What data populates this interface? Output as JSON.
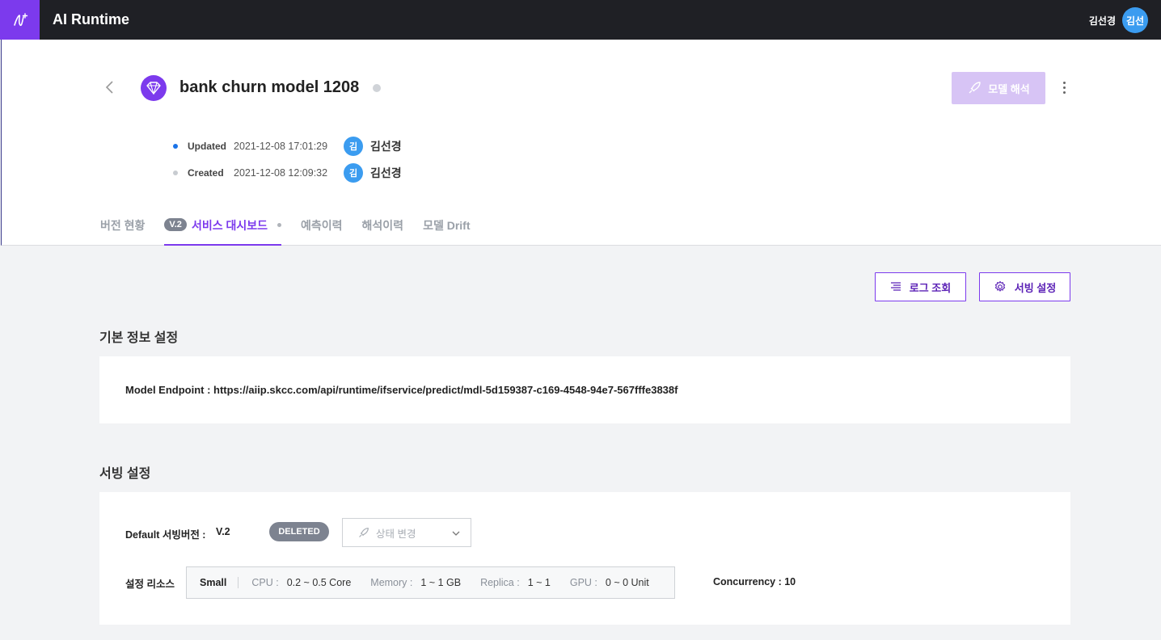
{
  "app": {
    "title": "AI Runtime",
    "logo_icon": "ai-logo-icon"
  },
  "user": {
    "name": "김선경",
    "avatar_text": "김선"
  },
  "model": {
    "title": "bank churn model 1208",
    "icon": "diamond-icon"
  },
  "header_actions": {
    "interpret_label": "모델 해석"
  },
  "meta": {
    "updated": {
      "label": "Updated",
      "timestamp": "2021-12-08 17:01:29",
      "avatar": "김",
      "user": "김선경",
      "dot_color": "#1a73e8"
    },
    "created": {
      "label": "Created",
      "timestamp": "2021-12-08 12:09:32",
      "avatar": "김",
      "user": "김선경",
      "dot_color": "#c8ccd1"
    }
  },
  "tabs": [
    {
      "label": "버전 현황"
    },
    {
      "label": "서비스 대시보드",
      "badge": "V.2",
      "active": true
    },
    {
      "label": "예측이력"
    },
    {
      "label": "해석이력"
    },
    {
      "label": "모델 Drift"
    }
  ],
  "actions": {
    "log_label": "로그 조회",
    "serving_label": "서빙 설정"
  },
  "basic_info": {
    "title": "기본 정보 설정",
    "endpoint": "Model Endpoint : https://aiip.skcc.com/api/runtime/ifservice/predict/mdl-5d159387-c169-4548-94e7-567fffe3838f"
  },
  "serving": {
    "title": "서빙 설정",
    "default_label": "Default 서빙버전 :",
    "default_value": "V.2",
    "status_badge": "DELETED",
    "state_change_placeholder": "상태 변경",
    "resource_label": "설정 리소스",
    "resource": {
      "size": "Small",
      "cpu_label": "CPU :",
      "cpu": "0.2 ~ 0.5 Core",
      "memory_label": "Memory :",
      "memory": "1 ~ 1 GB",
      "replica_label": "Replica :",
      "replica": "1 ~ 1",
      "gpu_label": "GPU :",
      "gpu": "0 ~ 0 Unit"
    },
    "concurrency": "Concurrency : 10"
  },
  "colors": {
    "accent": "#7c3aed",
    "topbar": "#1f2025",
    "avatar": "#3b9cf0"
  }
}
